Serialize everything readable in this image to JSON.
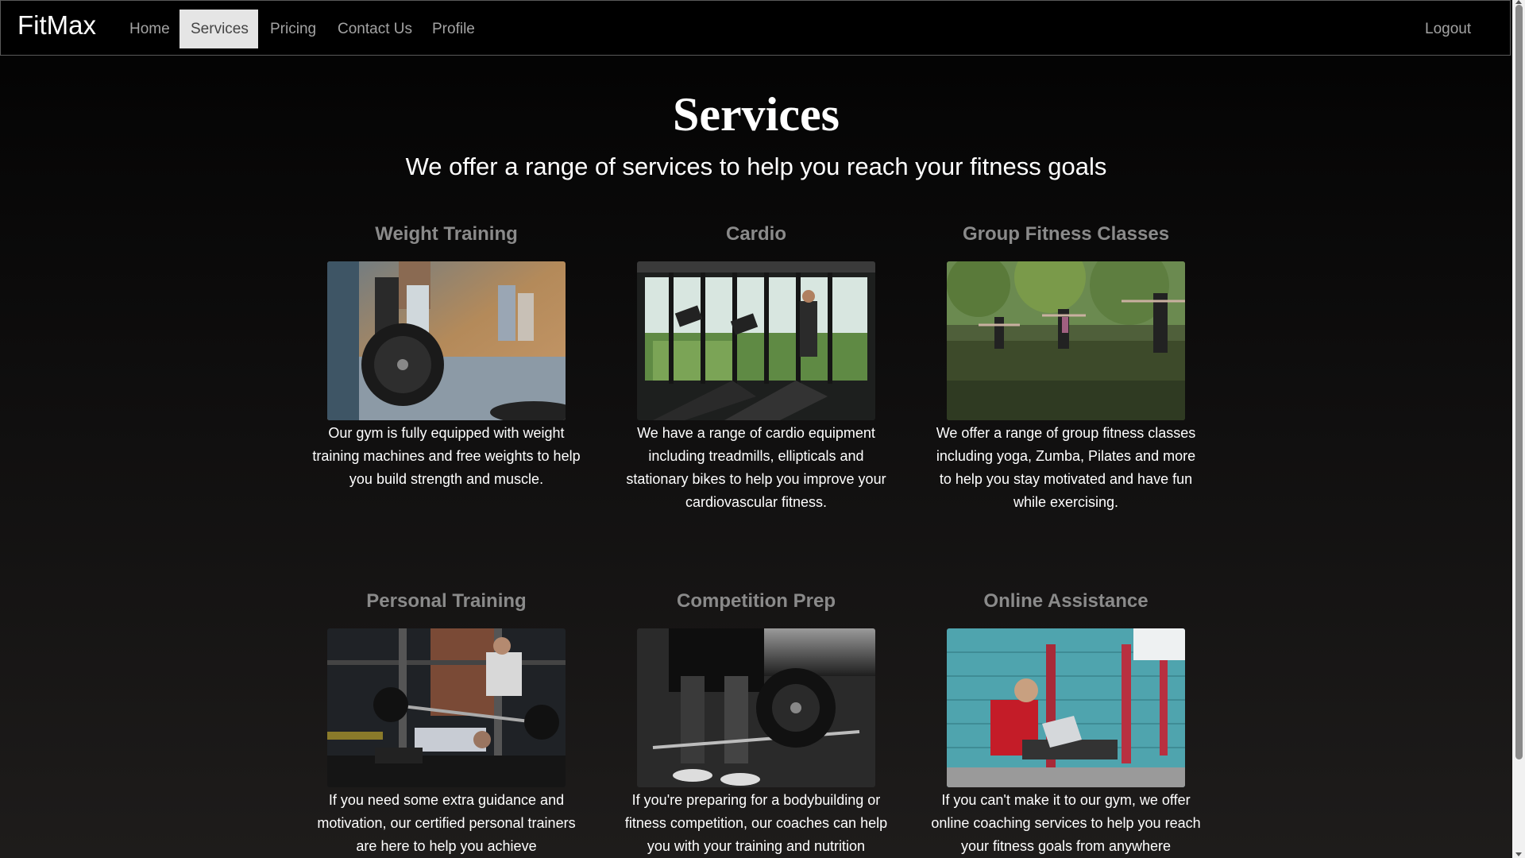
{
  "app": {
    "brand": "FitMax"
  },
  "nav": {
    "items": [
      {
        "label": "Home"
      },
      {
        "label": "Services"
      },
      {
        "label": "Pricing"
      },
      {
        "label": "Contact Us"
      },
      {
        "label": "Profile"
      }
    ],
    "active": "Services",
    "logout": "Logout"
  },
  "header": {
    "title": "Services",
    "subtitle": "We offer a range of services to help you reach your fitness goals"
  },
  "services": [
    {
      "title": "Weight Training",
      "description": "Our gym is fully equipped with weight training machines and free weights to help you build strength and muscle."
    },
    {
      "title": "Cardio",
      "description": "We have a range of cardio equipment including treadmills, ellipticals and stationary bikes to help you improve your cardiovascular fitness."
    },
    {
      "title": "Group Fitness Classes",
      "description": "We offer a range of group fitness classes including yoga, Zumba, Pilates and more to help you stay motivated and have fun while exercising."
    },
    {
      "title": "Personal Training",
      "description": "If you need some extra guidance and motivation, our certified personal trainers are here to help you achieve"
    },
    {
      "title": "Competition Prep",
      "description": "If you're preparing for a bodybuilding or fitness competition, our coaches can help you with your training and nutrition"
    },
    {
      "title": "Online Assistance",
      "description": "If you can't make it to our gym, we offer online coaching services to help you reach your fitness goals from anywhere"
    }
  ],
  "colors": {
    "background": "#000000",
    "nav_active_bg": "#e5e5e5",
    "nav_text": "#a3a3a3",
    "card_title": "#8a8a8a",
    "text": "#ffffff"
  }
}
